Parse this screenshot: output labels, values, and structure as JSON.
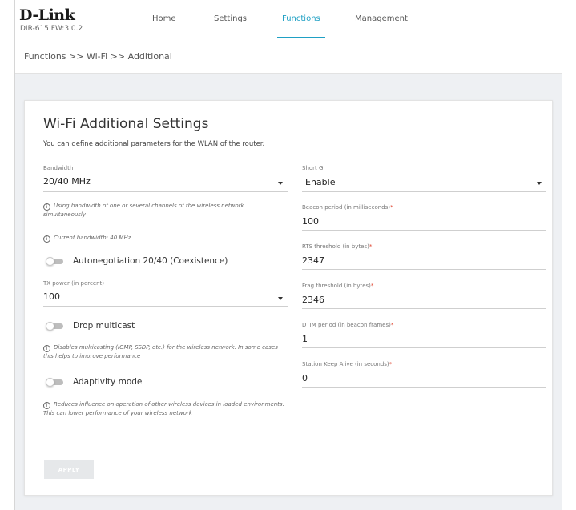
{
  "brand": {
    "logo": "D-Link",
    "firmware": "DIR-615 FW:3.0.2"
  },
  "nav": [
    {
      "label": "Home"
    },
    {
      "label": "Settings"
    },
    {
      "label": "Functions"
    },
    {
      "label": "Management"
    }
  ],
  "active_nav": "Functions",
  "breadcrumb": "Functions >> Wi-Fi >> Additional",
  "page": {
    "title": "Wi-Fi Additional Settings",
    "subtitle": "You can define additional parameters for the WLAN of the router."
  },
  "left": {
    "bandwidth": {
      "label": "Bandwidth",
      "value": "20/40 MHz"
    },
    "bandwidth_hint": "Using bandwidth of one or several channels of the wireless network simultaneously",
    "current_bandwidth": "Current bandwidth: 40 MHz",
    "autonegotiation": {
      "label": "Autonegotiation 20/40 (Coexistence)",
      "on": false
    },
    "tx_power": {
      "label": "TX power (in percent)",
      "value": "100"
    },
    "drop_multicast": {
      "label": "Drop multicast",
      "on": false
    },
    "drop_multicast_hint": "Disables multicasting (IGMP, SSDP, etc.) for the wireless network. In some cases this helps to improve performance",
    "adaptivity": {
      "label": "Adaptivity mode",
      "on": false
    },
    "adaptivity_hint": "Reduces influence on operation of other wireless devices in loaded environments. This can lower performance of your wireless network"
  },
  "right": {
    "short_gi": {
      "label": "Short GI",
      "value": "Enable"
    },
    "beacon": {
      "label": "Beacon period (in milliseconds)",
      "value": "100"
    },
    "rts": {
      "label": "RTS threshold (in bytes)",
      "value": "2347"
    },
    "frag": {
      "label": "Frag threshold (in bytes)",
      "value": "2346"
    },
    "dtim": {
      "label": "DTIM period (in beacon frames)",
      "value": "1"
    },
    "keepalive": {
      "label": "Station Keep Alive (in seconds)",
      "value": "0"
    },
    "required_mark": "*"
  },
  "apply_label": "APPLY",
  "colors": {
    "accent": "#1fa0c4",
    "required": "#e0442f",
    "button_disabled": "#e6e8ea"
  },
  "icons": {
    "info": "info-circle-icon",
    "caret": "caret-down-icon"
  }
}
